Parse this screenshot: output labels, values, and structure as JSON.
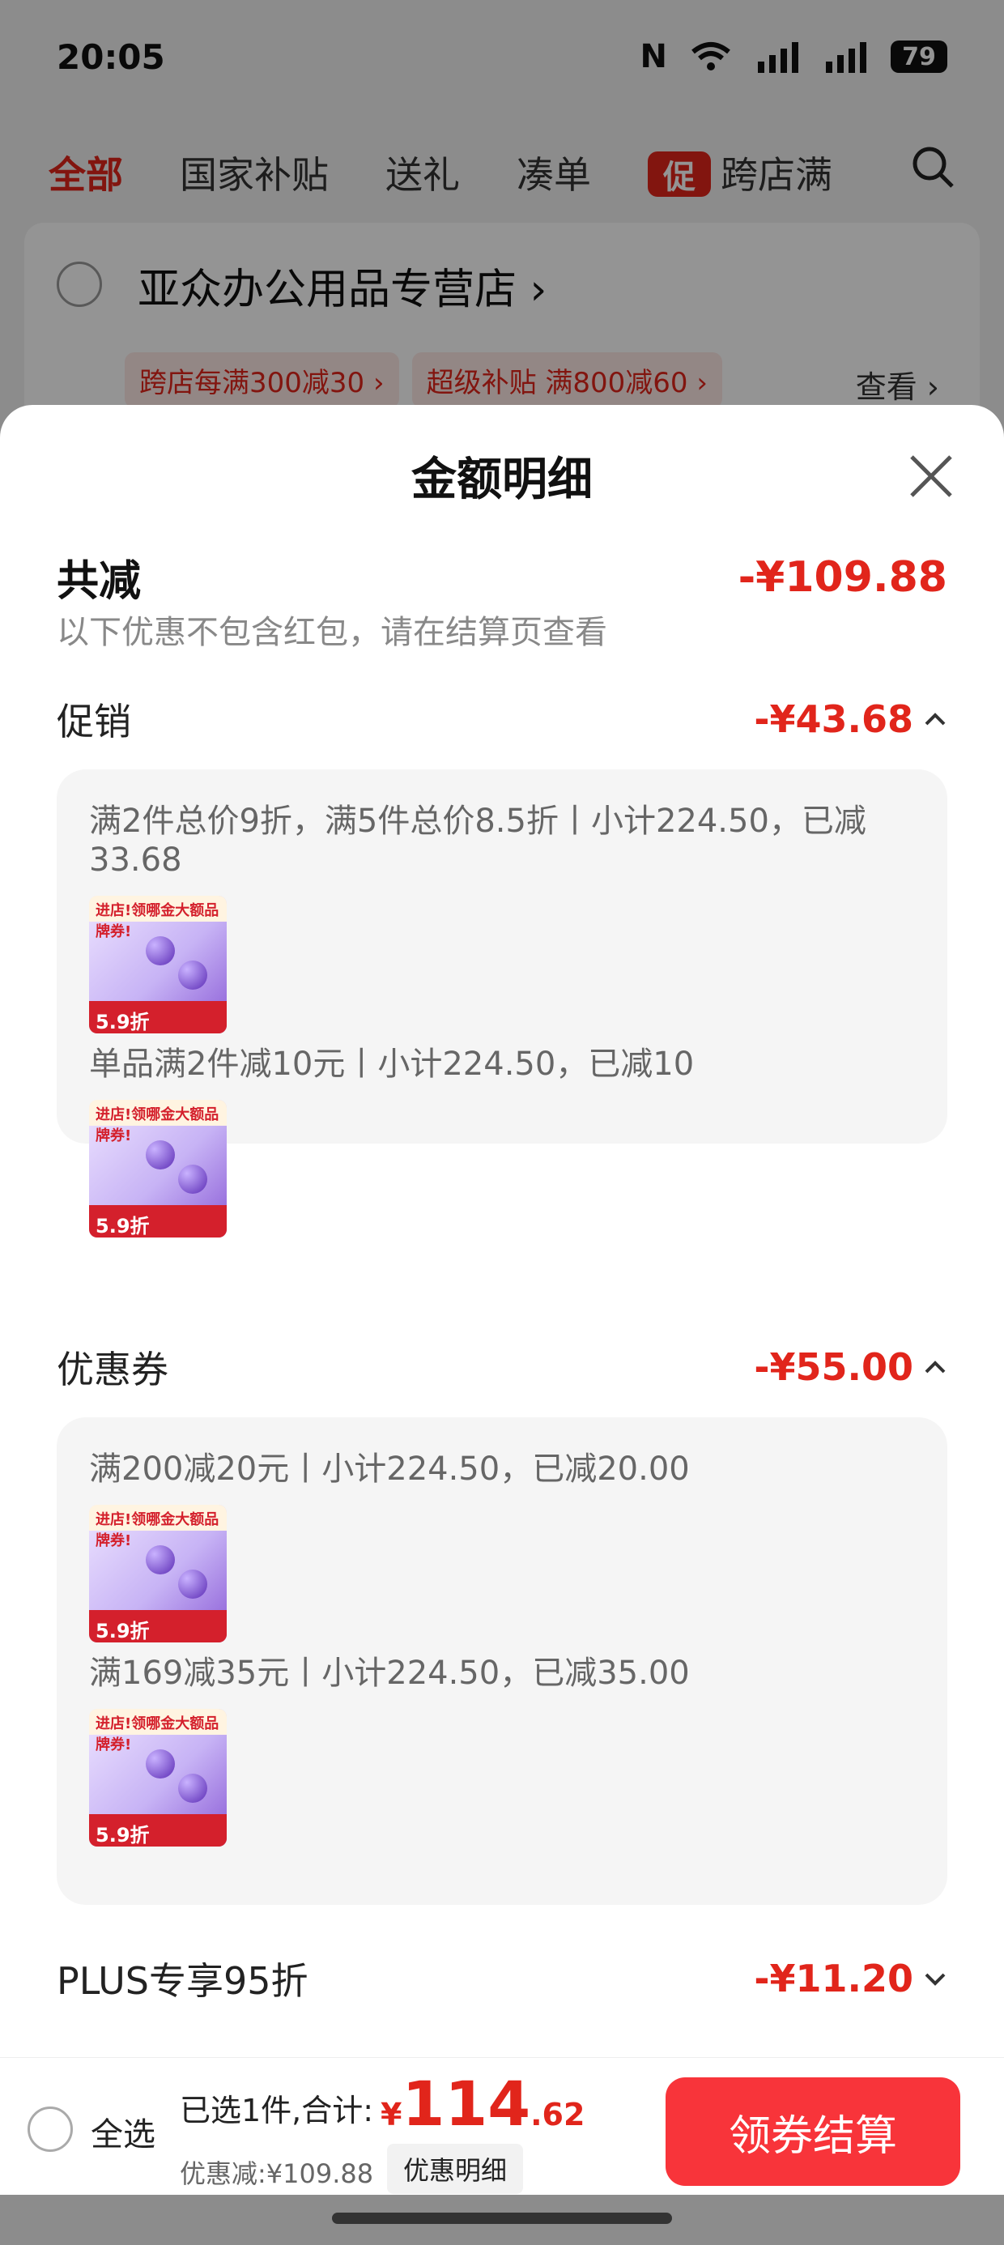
{
  "status_bar": {
    "time": "20:05",
    "battery": "79"
  },
  "background_app": {
    "tabs": [
      "全部",
      "国家补贴",
      "送礼",
      "凑单"
    ],
    "promo_badge": "促",
    "promo_tab": "跨店满",
    "store": {
      "name": "亚众办公用品专营店 ›",
      "tags": [
        "跨店每满300减30 ›",
        "超级补贴 满800减60 ›"
      ],
      "view": "查看 ›"
    }
  },
  "sheet": {
    "title": "金额明细",
    "summary": {
      "label": "共减",
      "amount": "-¥109.88",
      "note": "以下优惠不包含红包，请在结算页查看"
    },
    "promotion": {
      "label": "促销",
      "amount": "-¥43.68",
      "items": [
        "满2件总价9折，满5件总价8.5折丨小计224.50，已减33.68",
        "单品满2件减10元丨小计224.50，已减10"
      ]
    },
    "coupon": {
      "label": "优惠券",
      "amount": "-¥55.00",
      "items": [
        "满200减20元丨小计224.50，已减20.00",
        "满169减35元丨小计224.50，已减35.00"
      ]
    },
    "plus": {
      "label": "PLUS专享95折",
      "amount": "-¥11.20"
    },
    "thumbnail": {
      "top_text": "进店!领哪金大额品牌券!",
      "bottom_text": "5.9折"
    }
  },
  "bottom_bar": {
    "select_all": "全选",
    "selected": "已选1件,合计:",
    "price_symbol": "¥",
    "price_int": "114",
    "price_dec": ".62",
    "discount": "优惠减:¥109.88",
    "discount_detail": "优惠明细",
    "checkout": "领券结算"
  },
  "colors": {
    "accent": "#e1251b",
    "checkout": "#f8343a"
  }
}
